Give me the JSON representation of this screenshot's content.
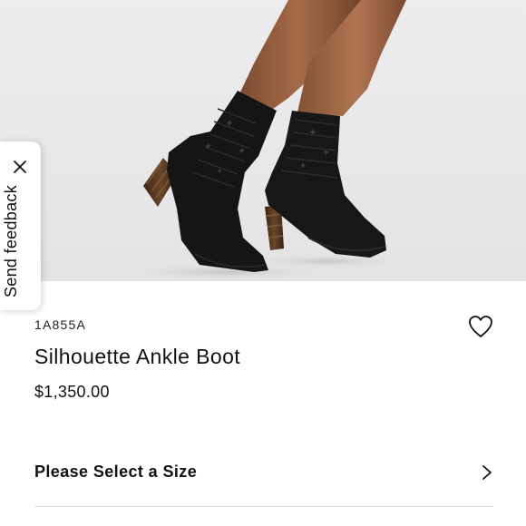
{
  "product": {
    "sku": "1A855A",
    "title": "Silhouette Ankle Boot",
    "price": "$1,350.00",
    "image_icon": "product-photo"
  },
  "feedback": {
    "label": "Send feedback",
    "close_icon": "close-icon"
  },
  "actions": {
    "wishlist_icon": "heart-icon",
    "size_select_label": "Please Select a Size",
    "size_select_icon": "chevron-right-icon"
  },
  "colors": {
    "background": "#ffffff",
    "hero_background": "#e9e8ea",
    "text": "#111111",
    "divider": "#d8d8d8"
  }
}
